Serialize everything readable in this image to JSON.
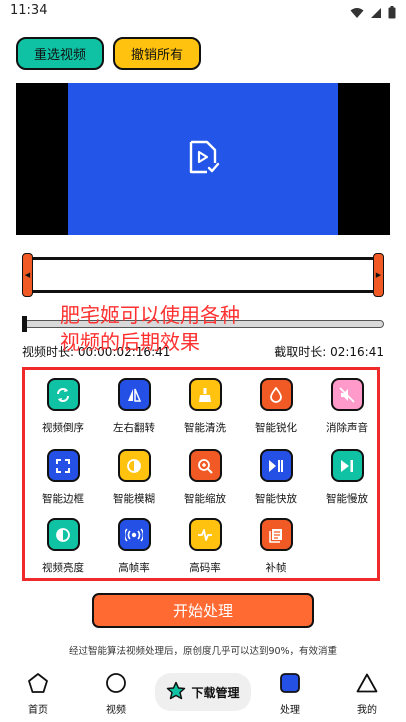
{
  "status": {
    "time": "11:34"
  },
  "actions": {
    "reselect": "重选视频",
    "undo_all": "撤销所有"
  },
  "overlay": {
    "line1": "肥宅姬可以使用各种",
    "line2": "视频的后期效果"
  },
  "meta": {
    "duration": "视频时长: 00:00:02:16:41",
    "clip_duration": "截取时长: 02:16:41"
  },
  "tools": [
    {
      "label": "视频倒序",
      "icon": "reverse-icon",
      "color": "#10c2a4"
    },
    {
      "label": "左右翻转",
      "icon": "flip-icon",
      "color": "#2550e6"
    },
    {
      "label": "智能清洗",
      "icon": "clean-icon",
      "color": "#ffc20e"
    },
    {
      "label": "智能锐化",
      "icon": "sharpen-icon",
      "color": "#f15a24"
    },
    {
      "label": "消除声音",
      "icon": "mute-icon",
      "color": "#ff9acb"
    },
    {
      "label": "智能边框",
      "icon": "border-icon",
      "color": "#2550e6"
    },
    {
      "label": "智能模糊",
      "icon": "blur-icon",
      "color": "#ffc20e"
    },
    {
      "label": "智能缩放",
      "icon": "zoom-icon",
      "color": "#f15a24"
    },
    {
      "label": "智能快放",
      "icon": "fast-play-icon",
      "color": "#2550e6"
    },
    {
      "label": "智能慢放",
      "icon": "slow-play-icon",
      "color": "#10c2a4"
    },
    {
      "label": "视频亮度",
      "icon": "brightness-icon",
      "color": "#10c2a4"
    },
    {
      "label": "高帧率",
      "icon": "framerate-icon",
      "color": "#2550e6"
    },
    {
      "label": "高码率",
      "icon": "bitrate-icon",
      "color": "#ffc20e"
    },
    {
      "label": "补帧",
      "icon": "interpolate-icon",
      "color": "#f15a24"
    }
  ],
  "start_button": "开始处理",
  "note": "经过智能算法视频处理后，原创度几乎可以达到90%，有效消重",
  "tabs": {
    "home": "首页",
    "video": "视频",
    "download": "下载管理",
    "process": "处理",
    "mine": "我的"
  },
  "colors": {
    "teal": "#10c2a4",
    "yellow": "#ffc20e",
    "blue": "#2550e6",
    "orange": "#f15a24",
    "red": "#ee2a2a"
  }
}
